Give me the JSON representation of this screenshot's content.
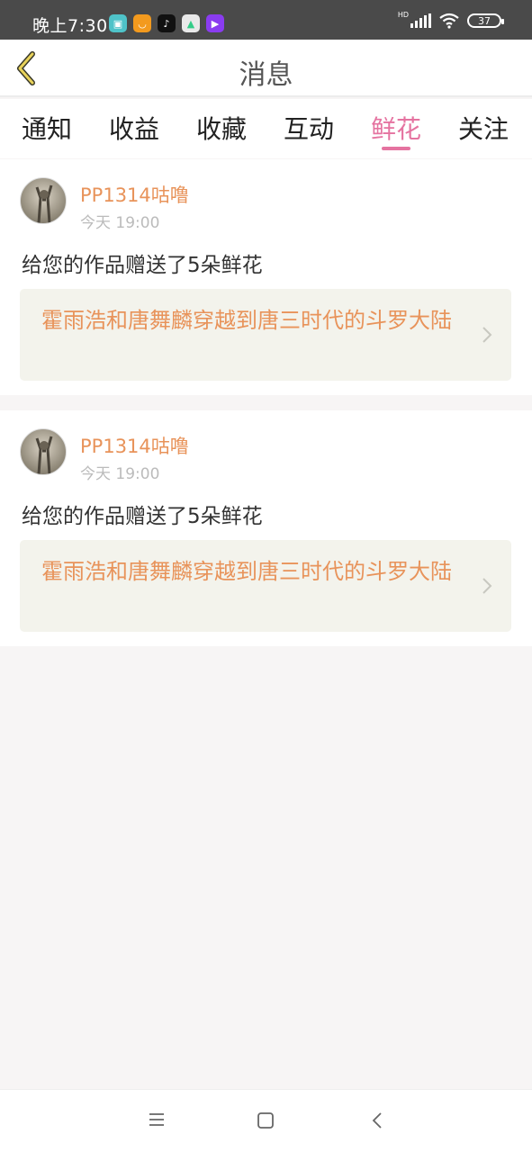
{
  "status": {
    "time": "晚上7:30",
    "hd": "HD",
    "battery": "37",
    "apps": [
      {
        "icon": "game-icon",
        "color": "#4fc3c9"
      },
      {
        "icon": "smile-icon",
        "color": "#f39a1e"
      },
      {
        "icon": "tiktok-icon",
        "color": "#111111"
      },
      {
        "icon": "maps-icon",
        "color": "#e9e9e9"
      },
      {
        "icon": "video-icon",
        "color": "#8a3cf0"
      }
    ]
  },
  "header": {
    "title": "消息"
  },
  "tabs": [
    {
      "label": "通知"
    },
    {
      "label": "收益"
    },
    {
      "label": "收藏"
    },
    {
      "label": "互动"
    },
    {
      "label": "鲜花",
      "active": true
    },
    {
      "label": "关注"
    }
  ],
  "colors": {
    "accent": "#e573a0",
    "username": "#e8935a"
  },
  "messages": [
    {
      "username": "PP1314咕噜",
      "time": "今天 19:00",
      "text": "给您的作品赠送了5朵鲜花",
      "work_title": "霍雨浩和唐舞麟穿越到唐三时代的斗罗大陆"
    },
    {
      "username": "PP1314咕噜",
      "time": "今天 19:00",
      "text": "给您的作品赠送了5朵鲜花",
      "work_title": "霍雨浩和唐舞麟穿越到唐三时代的斗罗大陆"
    }
  ]
}
